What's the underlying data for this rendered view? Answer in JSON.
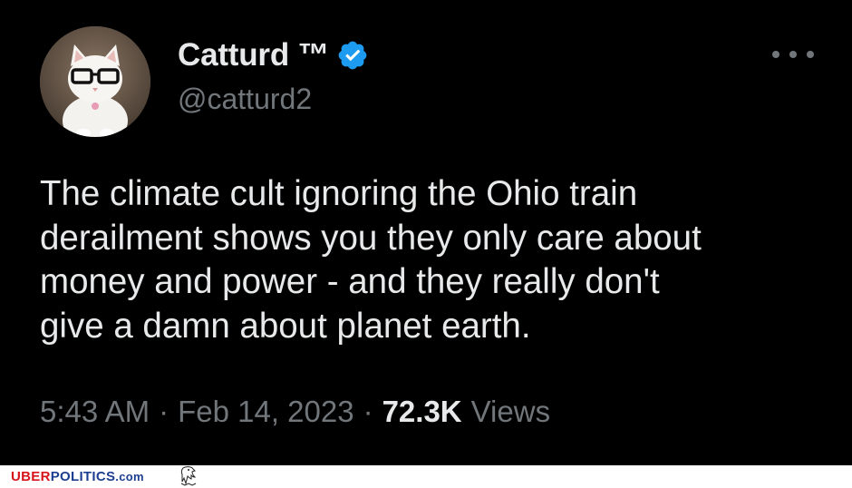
{
  "tweet": {
    "author": {
      "display_name": "Catturd ™",
      "handle": "@catturd2",
      "verified": true,
      "avatar_icon": "cat-with-glasses-avatar"
    },
    "text_lines": [
      "The climate cult ignoring the Ohio train",
      "derailment shows you they only care about",
      "money and power - and they really don't",
      "give a damn about planet earth."
    ],
    "time": "5:43 AM",
    "separator": "·",
    "date": "Feb 14, 2023",
    "views_count": "72.3K",
    "views_label": "Views",
    "more_icon": "more-options-icon"
  },
  "watermark": {
    "brand_part1": "UBER",
    "brand_part2": "POLITICS",
    "brand_part3": ".com",
    "icon": "eagle-icon"
  },
  "colors": {
    "background": "#000000",
    "text_primary": "#e7e9ea",
    "text_secondary": "#71767b",
    "verified_blue": "#1d9bf0",
    "brand_red": "#d7141a",
    "brand_blue": "#1d3f91"
  }
}
